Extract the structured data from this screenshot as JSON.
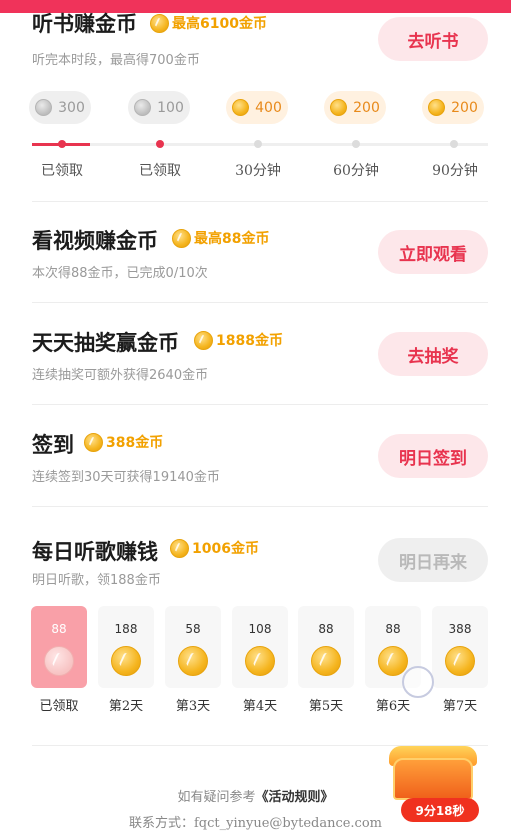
{
  "tasks": {
    "listen": {
      "title": "听书赚金币",
      "reward": "最高6100金币",
      "desc": "听完本时段，最高得700金币",
      "button": "去听书",
      "milestones": [
        {
          "amount": "300",
          "label": "已领取",
          "state": "claimed"
        },
        {
          "amount": "100",
          "label": "已领取",
          "state": "claimed"
        },
        {
          "amount": "400",
          "label": "30分钟",
          "state": "pending"
        },
        {
          "amount": "200",
          "label": "60分钟",
          "state": "pending"
        },
        {
          "amount": "200",
          "label": "90分钟",
          "state": "pending"
        }
      ]
    },
    "video": {
      "title": "看视频赚金币",
      "reward": "最高88金币",
      "desc": "本次得88金币，已完成0/10次",
      "button": "立即观看"
    },
    "lottery": {
      "title": "天天抽奖赢金币",
      "reward": "1888金币",
      "desc": "连续抽奖可额外获得2640金币",
      "button": "去抽奖"
    },
    "signin": {
      "title": "签到",
      "reward": "388金币",
      "desc": "连续签到30天可获得19140金币",
      "button": "明日签到"
    },
    "music": {
      "title": "每日听歌赚钱",
      "reward": "1006金币",
      "desc": "明日听歌，领188金币",
      "button": "明日再来",
      "days": [
        {
          "amount": "88",
          "label": "已领取",
          "state": "claimed"
        },
        {
          "amount": "188",
          "label": "第2天",
          "state": "pending"
        },
        {
          "amount": "58",
          "label": "第3天",
          "state": "pending"
        },
        {
          "amount": "108",
          "label": "第4天",
          "state": "pending"
        },
        {
          "amount": "88",
          "label": "第5天",
          "state": "pending"
        },
        {
          "amount": "88",
          "label": "第6天",
          "state": "pending"
        },
        {
          "amount": "388",
          "label": "第7天",
          "state": "pending"
        }
      ]
    }
  },
  "footer": {
    "question_prefix": "如有疑问参考",
    "rules_link": "《活动规则》",
    "contact_prefix": "联系方式：",
    "contact_email": "fqct_yinyue@bytedance.com"
  },
  "floating_chest": {
    "timer": "9分18秒"
  },
  "colors": {
    "accent": "#e8344f",
    "coin": "#f2a100",
    "topbar": "#f0335a"
  }
}
